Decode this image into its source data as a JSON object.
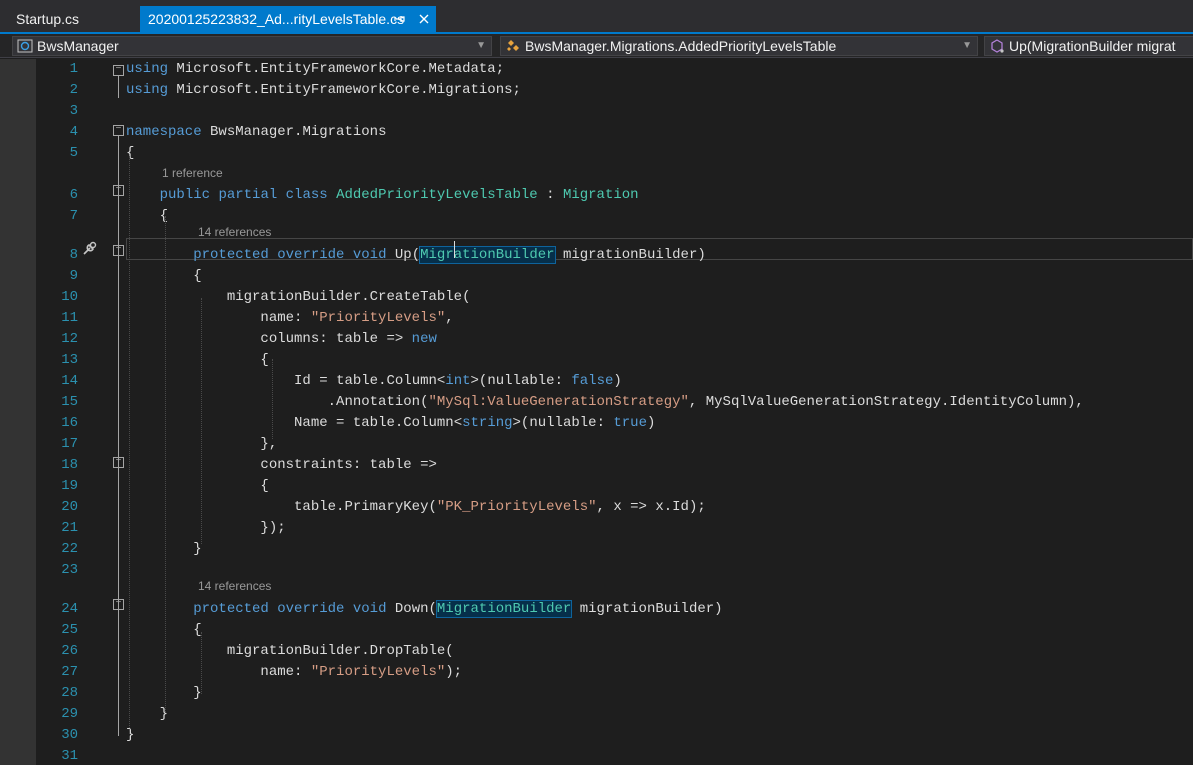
{
  "tabs": [
    {
      "label": "Startup.cs",
      "active": false
    },
    {
      "label": "20200125223832_Ad...rityLevelsTable.cs",
      "active": true
    }
  ],
  "tab_icons": {
    "pin": "pin-icon",
    "close": "close-icon"
  },
  "navbar": {
    "project": "BwsManager",
    "class": "BwsManager.Migrations.AddedPriorityLevelsTable",
    "member": "Up(MigrationBuilder migrat"
  },
  "lens": {
    "class_refs": "1 reference",
    "up_refs": "14 references",
    "down_refs": "14 references"
  },
  "code_lines": [
    {
      "n": "1",
      "text": "using Microsoft.EntityFrameworkCore.Metadata;"
    },
    {
      "n": "2",
      "text": "using Microsoft.EntityFrameworkCore.Migrations;"
    },
    {
      "n": "3",
      "text": ""
    },
    {
      "n": "4",
      "text": "namespace BwsManager.Migrations"
    },
    {
      "n": "5",
      "text": "{"
    },
    {
      "n": "6",
      "text": "    public partial class AddedPriorityLevelsTable : Migration"
    },
    {
      "n": "7",
      "text": "    {"
    },
    {
      "n": "8",
      "text": "        protected override void Up(MigrationBuilder migrationBuilder)"
    },
    {
      "n": "9",
      "text": "        {"
    },
    {
      "n": "10",
      "text": "            migrationBuilder.CreateTable("
    },
    {
      "n": "11",
      "text": "                name: \"PriorityLevels\","
    },
    {
      "n": "12",
      "text": "                columns: table => new"
    },
    {
      "n": "13",
      "text": "                {"
    },
    {
      "n": "14",
      "text": "                    Id = table.Column<int>(nullable: false)"
    },
    {
      "n": "15",
      "text": "                        .Annotation(\"MySql:ValueGenerationStrategy\", MySqlValueGenerationStrategy.IdentityColumn),"
    },
    {
      "n": "16",
      "text": "                    Name = table.Column<string>(nullable: true)"
    },
    {
      "n": "17",
      "text": "                },"
    },
    {
      "n": "18",
      "text": "                constraints: table =>"
    },
    {
      "n": "19",
      "text": "                {"
    },
    {
      "n": "20",
      "text": "                    table.PrimaryKey(\"PK_PriorityLevels\", x => x.Id);"
    },
    {
      "n": "21",
      "text": "                });"
    },
    {
      "n": "22",
      "text": "        }"
    },
    {
      "n": "23",
      "text": ""
    },
    {
      "n": "24",
      "text": "        protected override void Down(MigrationBuilder migrationBuilder)"
    },
    {
      "n": "25",
      "text": "        {"
    },
    {
      "n": "26",
      "text": "            migrationBuilder.DropTable("
    },
    {
      "n": "27",
      "text": "                name: \"PriorityLevels\");"
    },
    {
      "n": "28",
      "text": "        }"
    },
    {
      "n": "29",
      "text": "    }"
    },
    {
      "n": "30",
      "text": "}"
    },
    {
      "n": "31",
      "text": ""
    }
  ],
  "colors": {
    "keyword": "#569cd6",
    "type": "#4ec9b0",
    "string": "#d69d85",
    "plain": "#dcdcdc",
    "line_number": "#2b91af",
    "accent": "#007acc"
  }
}
